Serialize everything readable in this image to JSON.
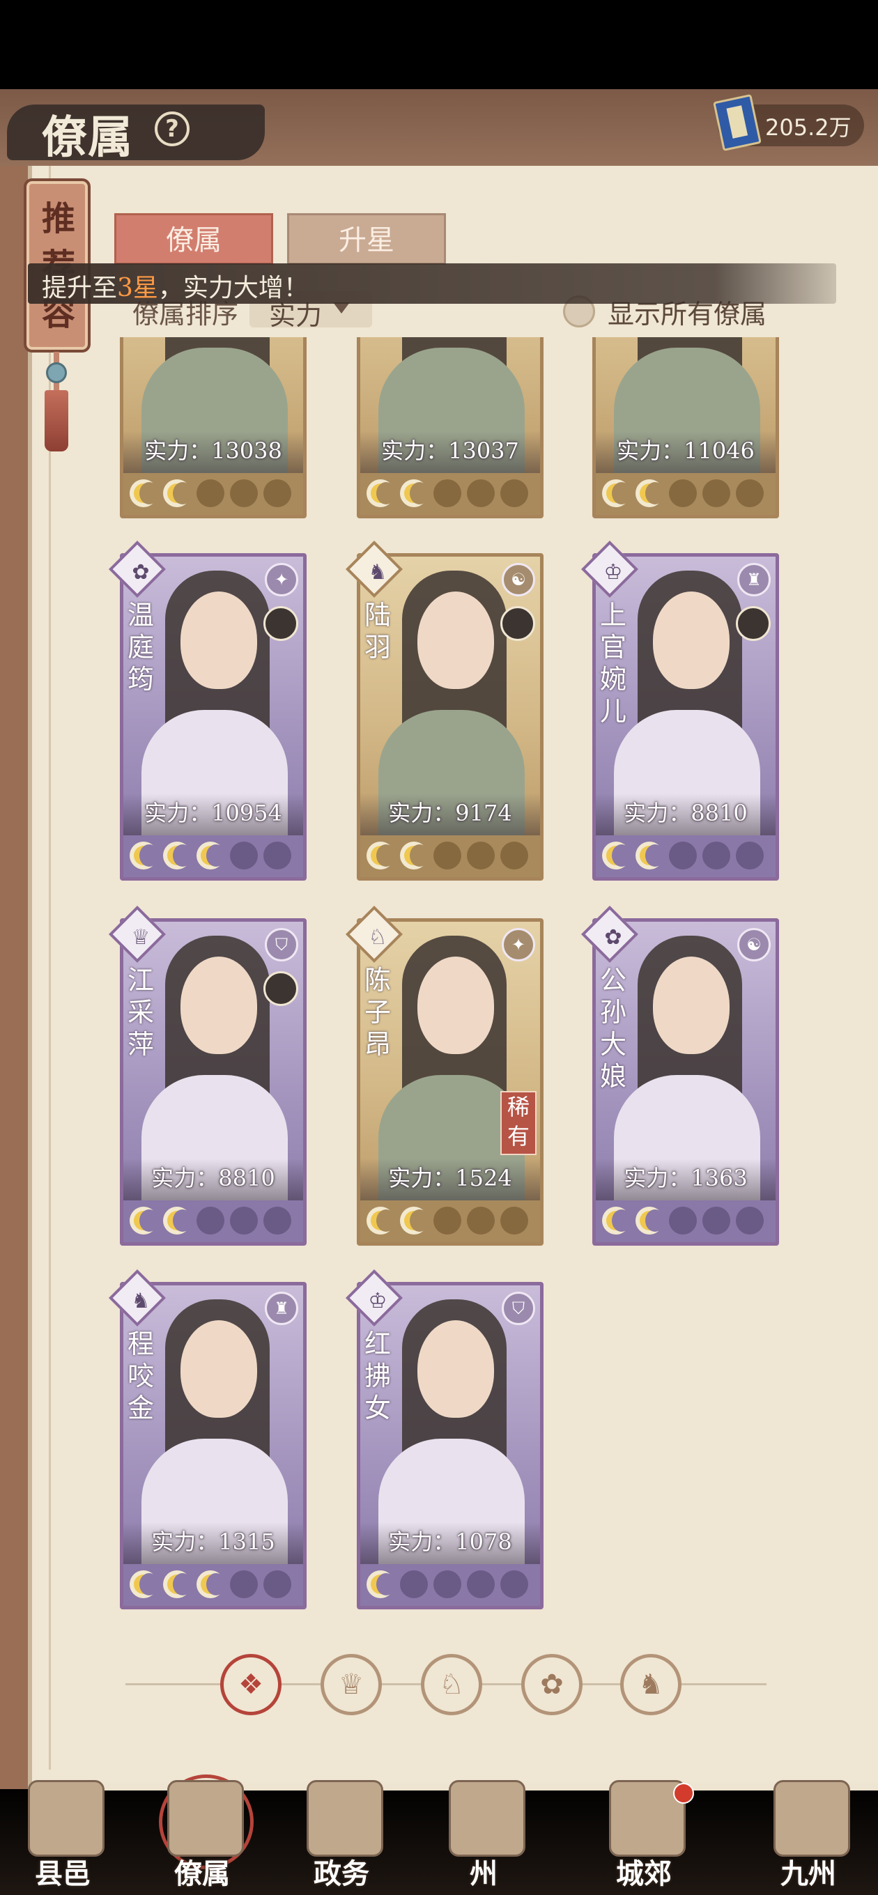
{
  "header": {
    "title": "僚属",
    "help_glyph": "?",
    "currency_value": "205.2万"
  },
  "recommend_tag": "推荐容",
  "tabs": [
    {
      "label": "僚属",
      "active": true
    },
    {
      "label": "升星",
      "active": false
    }
  ],
  "hint": {
    "prefix": "提升至",
    "highlight": "3星",
    "suffix": "，实力大增！"
  },
  "sort": {
    "label": "僚属排序",
    "value": "实力"
  },
  "show_all_label": "显示所有僚属",
  "cards": [
    {
      "name": "",
      "power": "实力：13038",
      "stars": 2,
      "style": "gold",
      "rare": false
    },
    {
      "name": "",
      "power": "实力：13037",
      "stars": 2,
      "style": "gold",
      "rare": false
    },
    {
      "name": "",
      "power": "实力：11046",
      "stars": 2,
      "style": "gold",
      "rare": false
    },
    {
      "name": "温庭筠",
      "power": "实力：10954",
      "stars": 3,
      "style": "purple",
      "rare": false
    },
    {
      "name": "陆羽",
      "power": "实力：9174",
      "stars": 2,
      "style": "gold",
      "rare": false
    },
    {
      "name": "上官婉儿",
      "power": "实力：8810",
      "stars": 2,
      "style": "purple",
      "rare": false
    },
    {
      "name": "江采萍",
      "power": "实力：8810",
      "stars": 2,
      "style": "purple",
      "rare": false
    },
    {
      "name": "陈子昂",
      "power": "实力：1524",
      "stars": 2,
      "style": "gold",
      "rare": true,
      "rare_label": "稀有"
    },
    {
      "name": "公孙大娘",
      "power": "实力：1363",
      "stars": 2,
      "style": "purple",
      "rare": false
    },
    {
      "name": "程咬金",
      "power": "实力：1315",
      "stars": 3,
      "style": "purple",
      "rare": false
    },
    {
      "name": "红拂女",
      "power": "实力：1078",
      "stars": 1,
      "style": "purple",
      "rare": false
    }
  ],
  "filters": [
    {
      "glyph": "❖",
      "name": "all",
      "active": true
    },
    {
      "glyph": "♕",
      "name": "faction-1",
      "active": false
    },
    {
      "glyph": "♘",
      "name": "faction-2",
      "active": false
    },
    {
      "glyph": "✿",
      "name": "faction-3",
      "active": false
    },
    {
      "glyph": "♞",
      "name": "faction-4",
      "active": false
    }
  ],
  "nav": [
    {
      "label": "县邑",
      "active": false
    },
    {
      "label": "僚属",
      "active": true
    },
    {
      "label": "政务",
      "active": false
    },
    {
      "label": "州",
      "active": false
    },
    {
      "label": "城郊",
      "active": false,
      "dot": true
    },
    {
      "label": "九州",
      "active": false
    }
  ],
  "colors": {
    "accent_red": "#b5443a",
    "tab_active": "#d27e6f",
    "hint_highlight": "#ff9a45",
    "card_purple": "#8a78a8",
    "card_gold": "#a98a5d"
  }
}
